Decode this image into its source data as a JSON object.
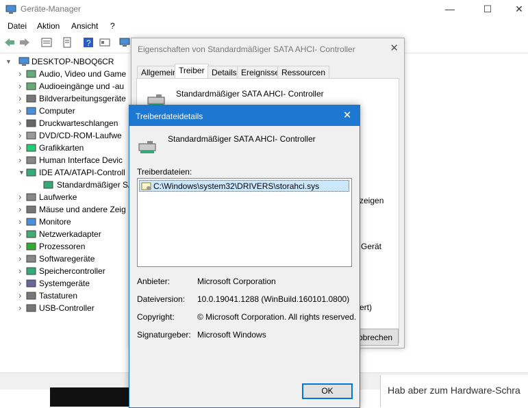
{
  "main_window": {
    "title": "Geräte-Manager",
    "controls": {
      "minimize": "—",
      "maximize": "☐",
      "close": "✕"
    },
    "menu": [
      "Datei",
      "Aktion",
      "Ansicht",
      "?"
    ],
    "tree": {
      "root": "DESKTOP-NBOQ6CR",
      "items": [
        {
          "label": "Audio, Video und Game",
          "icon": "speaker-icon"
        },
        {
          "label": "Audioeingänge und -au",
          "icon": "speaker-icon"
        },
        {
          "label": "Bildverarbeitungsgeräte",
          "icon": "camera-icon"
        },
        {
          "label": "Computer",
          "icon": "computer-icon"
        },
        {
          "label": "Druckwarteschlangen",
          "icon": "printer-icon"
        },
        {
          "label": "DVD/CD-ROM-Laufwe",
          "icon": "disc-drive-icon"
        },
        {
          "label": "Grafikkarten",
          "icon": "display-adapter-icon"
        },
        {
          "label": "Human Interface Devic",
          "icon": "hid-icon"
        },
        {
          "label": "IDE ATA/ATAPI-Controll",
          "icon": "ide-controller-icon",
          "expanded": true
        },
        {
          "label": "Standardmäßiger SA",
          "icon": "ide-controller-icon",
          "child": true
        },
        {
          "label": "Laufwerke",
          "icon": "disk-drive-icon"
        },
        {
          "label": "Mäuse und andere Zeig",
          "icon": "mouse-icon"
        },
        {
          "label": "Monitore",
          "icon": "monitor-icon"
        },
        {
          "label": "Netzwerkadapter",
          "icon": "network-icon"
        },
        {
          "label": "Prozessoren",
          "icon": "processor-icon"
        },
        {
          "label": "Softwaregeräte",
          "icon": "software-device-icon"
        },
        {
          "label": "Speichercontroller",
          "icon": "storage-controller-icon"
        },
        {
          "label": "Systemgeräte",
          "icon": "system-device-icon"
        },
        {
          "label": "Tastaturen",
          "icon": "keyboard-icon"
        },
        {
          "label": "USB-Controller",
          "icon": "usb-icon"
        }
      ]
    }
  },
  "properties_dialog": {
    "title": "Eigenschaften von Standardmäßiger SATA AHCI- Controller",
    "tabs": [
      "Allgemein",
      "Treiber",
      "Details",
      "Ereignisse",
      "Ressourcen"
    ],
    "active_tab": "Treiber",
    "device_name": "Standardmäßiger SATA AHCI- Controller",
    "partial_texts": [
      "zeigen",
      "Gerät",
      "ert)"
    ],
    "cancel_partial": "bbrechen"
  },
  "driver_dialog": {
    "title": "Treiberdateidetails",
    "device_name": "Standardmäßiger SATA AHCI- Controller",
    "files_label": "Treiberdateien:",
    "files": [
      "C:\\Windows\\system32\\DRIVERS\\storahci.sys"
    ],
    "details": [
      {
        "key": "Anbieter:",
        "value": "Microsoft Corporation"
      },
      {
        "key": "Dateiversion:",
        "value": "10.0.19041.1288 (WinBuild.160101.0800)"
      },
      {
        "key": "Copyright:",
        "value": "© Microsoft Corporation. All rights reserved."
      },
      {
        "key": "Signaturgeber:",
        "value": "Microsoft Windows"
      }
    ],
    "ok_label": "OK"
  },
  "background_text": "Hab aber zum Hardware-Schra",
  "colors": {
    "title_accent": "#1e78d2",
    "selection": "#cce8ff"
  }
}
